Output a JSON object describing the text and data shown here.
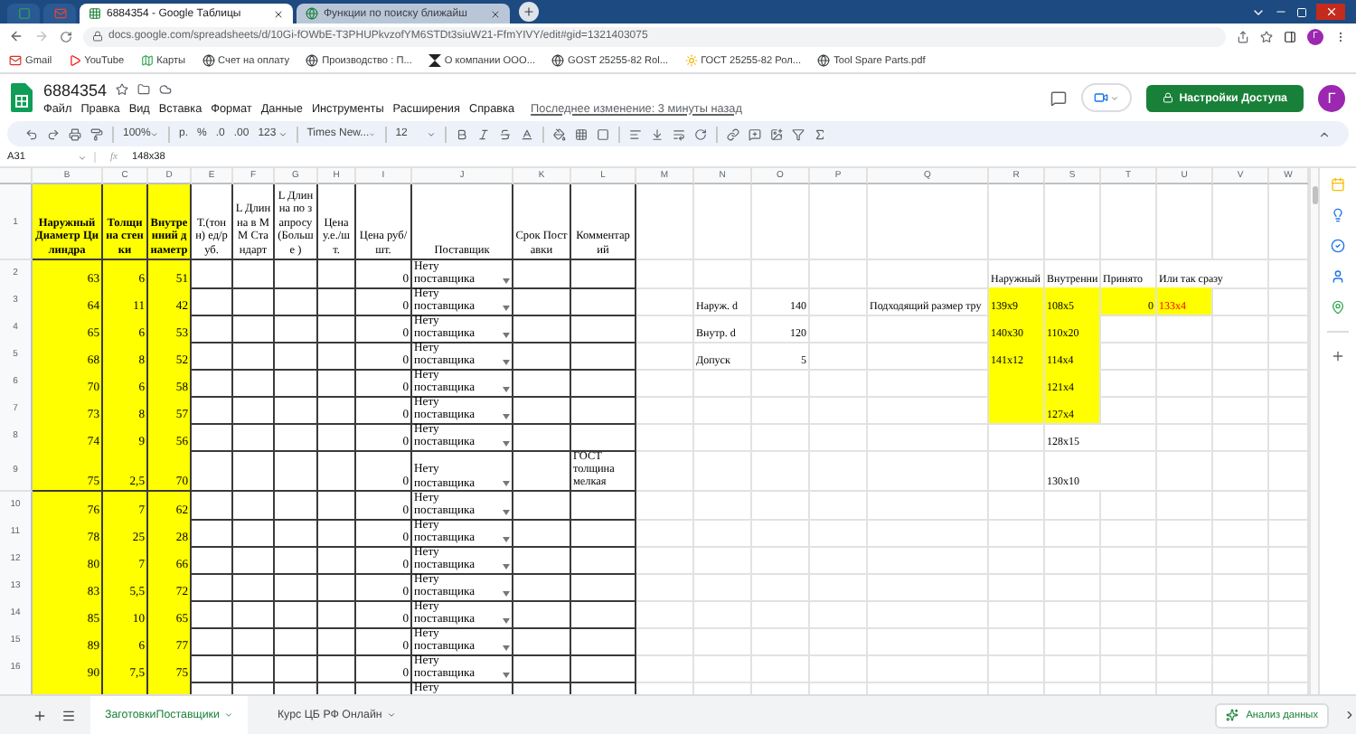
{
  "browser": {
    "tabs": [
      {
        "title": "6884354 - Google Таблицы",
        "selected": true
      },
      {
        "title": "Функции по поиску ближайш",
        "selected": false
      }
    ],
    "address": "docs.google.com/spreadsheets/d/10Gi-fOWbE-T3PHUPkvzofYM6STDt3siuW21-FfmYIVY/edit#gid=1321403075",
    "bookmarks": [
      {
        "label": "Gmail",
        "kind": "mail"
      },
      {
        "label": "YouTube",
        "kind": "video"
      },
      {
        "label": "Карты",
        "kind": "map"
      },
      {
        "label": "Счет на оплату",
        "kind": "globe"
      },
      {
        "label": "Производство : П...",
        "kind": "globe"
      },
      {
        "label": "О компании ООО...",
        "kind": "logo"
      },
      {
        "label": "GOST 25255-82 Rol...",
        "kind": "globe"
      },
      {
        "label": "ГОСТ 25255-82 Рол...",
        "kind": "sun"
      },
      {
        "label": "Tool Spare Parts.pdf",
        "kind": "globe"
      }
    ],
    "profile_initial": "Г"
  },
  "document": {
    "title": "6884354",
    "menus": [
      "Файл",
      "Правка",
      "Вид",
      "Вставка",
      "Формат",
      "Данные",
      "Инструменты",
      "Расширения",
      "Справка"
    ],
    "last_edit": "Последнее изменение: 3 минуты назад",
    "share_button": "Настройки Доступа",
    "avatar_initial": "Г"
  },
  "toolbar": {
    "zoom": "100%",
    "currency": "р.",
    "percent": "%",
    "decimal_less": ".0",
    "decimal_more": ".00",
    "number_format": "123",
    "font": "Times New...",
    "font_size": "12"
  },
  "formula_bar": {
    "cell": "A31",
    "fx_label": "fx",
    "value": "148х38"
  },
  "columns": [
    "B",
    "C",
    "D",
    "E",
    "F",
    "G",
    "H",
    "I",
    "J",
    "K",
    "L",
    "M",
    "N",
    "O",
    "P",
    "Q",
    "R",
    "S",
    "T",
    "U",
    "V",
    "W"
  ],
  "header_row": {
    "number": "1",
    "headings": [
      {
        "text": "Наружный Диаметр Цилиндра",
        "bold": true
      },
      {
        "text": "Толщина стенки",
        "bold": true
      },
      {
        "text": "Внутренний диаметр",
        "bold": true
      },
      {
        "text": "Т.(тонн) ед/руб.",
        "bold": false
      },
      {
        "text": "L Длинна в ММ Стандарт",
        "bold": false
      },
      {
        "text": "L Длинна по запросу (Больше )",
        "bold": false
      },
      {
        "text": "Цена у.е./шт.",
        "bold": false
      },
      {
        "text": "Цена руб/шт.",
        "bold": false
      },
      {
        "text": "Поставщик",
        "bold": false
      },
      {
        "text": "Срок Поставки",
        "bold": false
      },
      {
        "text": "Комментарий",
        "bold": false
      }
    ]
  },
  "rows": [
    {
      "kind": "full",
      "number": "2",
      "outer": "63",
      "wall": "6",
      "inner": "51",
      "price_rub": "0",
      "supplier": "Нету поставщика",
      "cells": {
        "r": {
          "text": "Наружный",
          "kind": "text",
          "highlighted": false
        },
        "s": {
          "text": "Внутренни",
          "kind": "text",
          "highlighted": false
        },
        "t": {
          "text": "Принято",
          "kind": "text",
          "highlighted": false
        },
        "u": {
          "text": "Или так сразу",
          "kind": "text",
          "highlighted": false
        }
      }
    },
    {
      "kind": "full",
      "number": "3",
      "outer": "64",
      "wall": "11",
      "inner": "42",
      "price_rub": "0",
      "supplier": "Нету поставщика",
      "cells": {
        "n": {
          "text": "Наруж. d",
          "kind": "text",
          "highlighted": false
        },
        "o": {
          "text": "140",
          "kind": "number",
          "highlighted": false
        },
        "q": {
          "text": "Подходящий размер тру",
          "kind": "text",
          "highlighted": false
        },
        "r": {
          "text": "139х9",
          "kind": "text",
          "highlighted": true
        },
        "s": {
          "text": "108х5",
          "kind": "text",
          "highlighted": true
        },
        "t": {
          "text": "0",
          "kind": "number",
          "highlighted": true
        },
        "u": {
          "text": "133х4",
          "kind": "alert",
          "highlighted": true
        }
      }
    },
    {
      "kind": "full",
      "number": "4",
      "outer": "65",
      "wall": "6",
      "inner": "53",
      "price_rub": "0",
      "supplier": "Нету поставщика",
      "cells": {
        "n": {
          "text": "Внутр. d",
          "kind": "text",
          "highlighted": false
        },
        "o": {
          "text": "120",
          "kind": "number",
          "highlighted": false
        },
        "r": {
          "text": "140х30",
          "kind": "text",
          "highlighted": true
        },
        "s": {
          "text": "110х20",
          "kind": "text",
          "highlighted": true
        }
      }
    },
    {
      "kind": "full",
      "number": "5",
      "outer": "68",
      "wall": "8",
      "inner": "52",
      "price_rub": "0",
      "supplier": "Нету поставщика",
      "cells": {
        "n": {
          "text": "Допуск",
          "kind": "text",
          "highlighted": false
        },
        "o": {
          "text": "5",
          "kind": "number",
          "highlighted": false
        },
        "r": {
          "text": "141х12",
          "kind": "text",
          "highlighted": true
        },
        "s": {
          "text": "114х4",
          "kind": "text",
          "highlighted": true
        }
      }
    },
    {
      "kind": "full",
      "number": "6",
      "outer": "70",
      "wall": "6",
      "inner": "58",
      "price_rub": "0",
      "supplier": "Нету поставщика",
      "cells": {
        "r": {
          "highlighted": true
        },
        "s": {
          "text": "121х4",
          "kind": "text",
          "highlighted": true
        }
      }
    },
    {
      "kind": "full",
      "number": "7",
      "outer": "73",
      "wall": "8",
      "inner": "57",
      "price_rub": "0",
      "supplier": "Нету поставщика",
      "cells": {
        "r": {
          "highlighted": true
        },
        "s": {
          "text": "127х4",
          "kind": "text",
          "highlighted": true
        }
      }
    },
    {
      "kind": "full",
      "number": "8",
      "outer": "74",
      "wall": "9",
      "inner": "56",
      "price_rub": "0",
      "supplier": "Нету поставщика",
      "cells": {
        "s": {
          "text": "128х15",
          "kind": "text",
          "highlighted": false
        }
      }
    },
    {
      "kind": "tall",
      "number": "9",
      "outer": "75",
      "wall": "2,5",
      "inner": "70",
      "price_rub": "0",
      "supplier": "Нету поставщика",
      "comment": "ГОСТ толщина мелкая",
      "cells": {
        "s": {
          "text": "130х10",
          "kind": "text",
          "highlighted": false
        }
      }
    },
    {
      "kind": "full",
      "number": "10",
      "outer": "76",
      "wall": "7",
      "inner": "62",
      "price_rub": "0",
      "supplier": "Нету поставщика"
    },
    {
      "kind": "full",
      "number": "11",
      "outer": "78",
      "wall": "25",
      "inner": "28",
      "price_rub": "0",
      "supplier": "Нету поставщика"
    },
    {
      "kind": "full",
      "number": "12",
      "outer": "80",
      "wall": "7",
      "inner": "66",
      "price_rub": "0",
      "supplier": "Нету поставщика"
    },
    {
      "kind": "full",
      "number": "13",
      "outer": "83",
      "wall": "5,5",
      "inner": "72",
      "price_rub": "0",
      "supplier": "Нету поставщика"
    },
    {
      "kind": "full",
      "number": "14",
      "outer": "85",
      "wall": "10",
      "inner": "65",
      "price_rub": "0",
      "supplier": "Нету поставщика"
    },
    {
      "kind": "full",
      "number": "15",
      "outer": "89",
      "wall": "6",
      "inner": "77",
      "price_rub": "0",
      "supplier": "Нету поставщика"
    },
    {
      "kind": "full",
      "number": "16",
      "outer": "90",
      "wall": "7,5",
      "inner": "75",
      "price_rub": "0",
      "supplier": "Нету поставщика"
    },
    {
      "kind": "cut",
      "supplier": "Нету"
    }
  ],
  "sheets": [
    {
      "name": "ЗаготовкиПоставщики",
      "selected": true
    },
    {
      "name": "Курс ЦБ РФ Онлайн",
      "selected": false
    }
  ],
  "explore_button": "Анализ данных"
}
